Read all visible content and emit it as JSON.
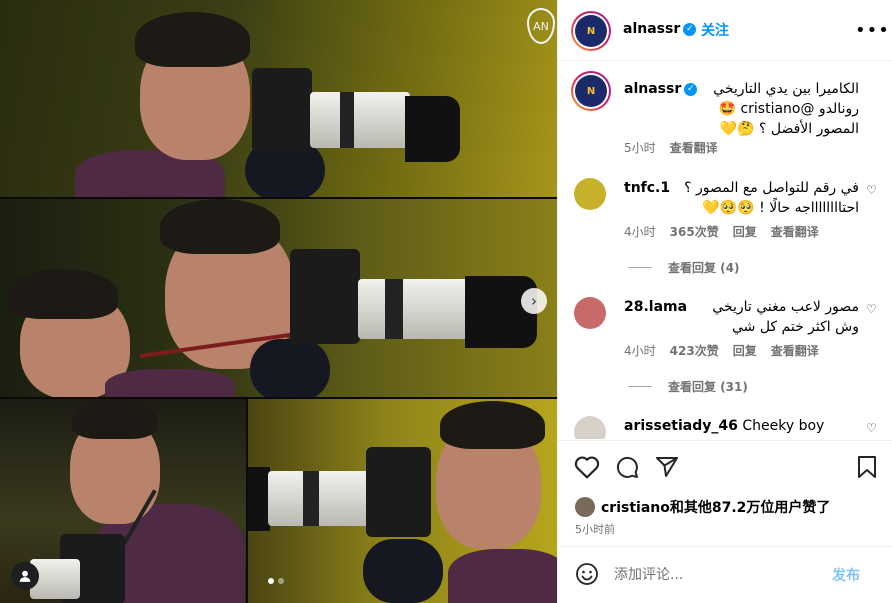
{
  "header": {
    "username": "alnassr",
    "follow_label": "关注",
    "more_label": "•••"
  },
  "media": {
    "brand_logo_text": "AN",
    "slide_count": 2,
    "active_slide": 1
  },
  "caption": {
    "username": "alnassr",
    "line1": "الكاميرا بين يدي التاريخي",
    "line2": "رونالدو @cristiano 🤩",
    "line3": "المصور الأفضل ؟ 🤔💛",
    "time": "5小时",
    "translate_label": "查看翻译"
  },
  "comments": [
    {
      "username": "tnfc.1",
      "line1": "في رقم للتواصل مع المصور ؟",
      "line2": "احتااااااااجه حالًا ! 🥺🥺💛",
      "time": "4小时",
      "likes": "365次赞",
      "reply_label": "回复",
      "translate_label": "查看翻译",
      "view_replies": "查看回复 (4)"
    },
    {
      "username": "28.lama",
      "line1": "مصور لاعب مغني تاريخي",
      "line2": "وش اكثر ختم كل شي",
      "time": "4小时",
      "likes": "423次赞",
      "reply_label": "回复",
      "translate_label": "查看翻译",
      "view_replies": "查看回复 (31)"
    },
    {
      "username": "arissetiady_46",
      "text": "Cheeky boy hehehe"
    }
  ],
  "likes": {
    "text": "cristiano和其他87.2万位用户赞了"
  },
  "post_time": "5小时前",
  "comment_box": {
    "placeholder": "添加评论...",
    "post_label": "发布"
  },
  "colors": {
    "link_blue": "#0095f6",
    "secondary_text": "#737373",
    "post_disabled": "#7fc4f8"
  }
}
